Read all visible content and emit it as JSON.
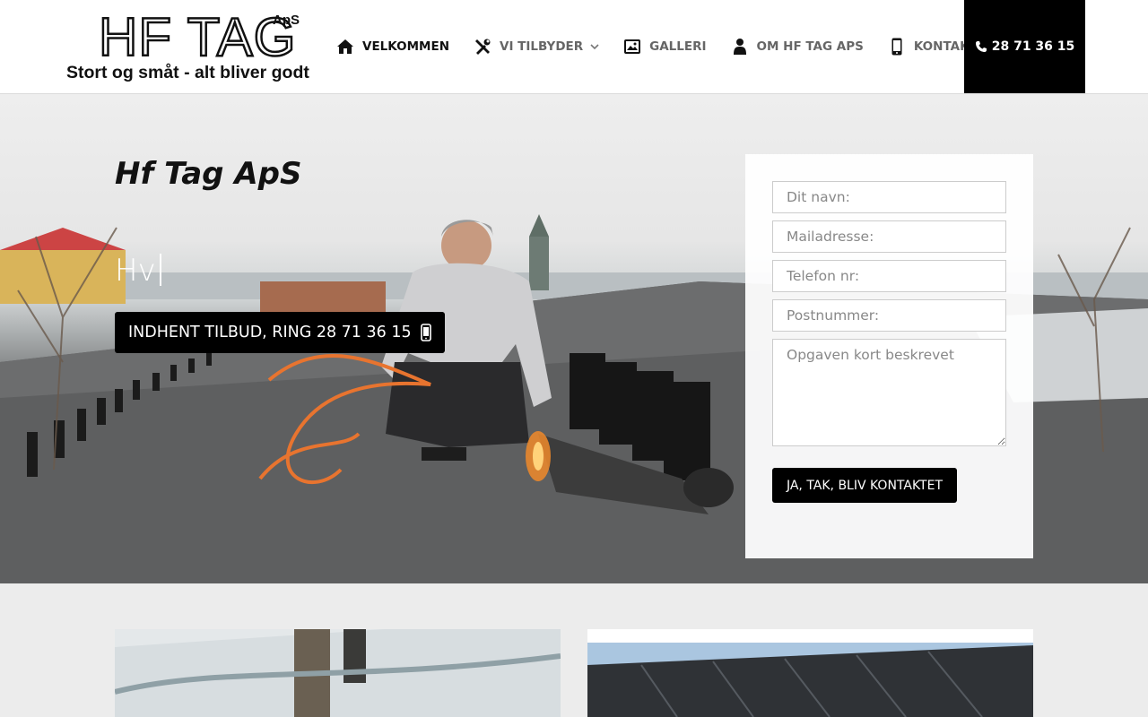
{
  "logo": {
    "main": "HF TAG",
    "suffix": "ApS",
    "tagline": "Stort og småt - alt bliver godt"
  },
  "nav": {
    "items": [
      {
        "label": "Velkommen",
        "icon": "home-icon",
        "active": true
      },
      {
        "label": "Vi tilbyder",
        "icon": "tools-icon",
        "dropdown": true
      },
      {
        "label": "Galleri",
        "icon": "gallery-icon"
      },
      {
        "label": "Om HF Tag ApS",
        "icon": "person-icon"
      },
      {
        "label": "Kontakt",
        "icon": "mobile-icon"
      }
    ],
    "phone": "28 71 36 15"
  },
  "hero": {
    "title": "Hf Tag ApS",
    "typed": "Hv",
    "cta": "INDHENT TILBUD, RING 28 71 36 15"
  },
  "form": {
    "name_placeholder": "Dit navn:",
    "email_placeholder": "Mailadresse:",
    "phone_placeholder": "Telefon nr:",
    "zip_placeholder": "Postnummer:",
    "message_placeholder": "Opgaven kort beskrevet",
    "submit": "JA, TAK, BLIV KONTAKTET"
  },
  "colors": {
    "accent": "#000000",
    "header_bg": "#ffffff",
    "page_bg": "#ececec"
  }
}
